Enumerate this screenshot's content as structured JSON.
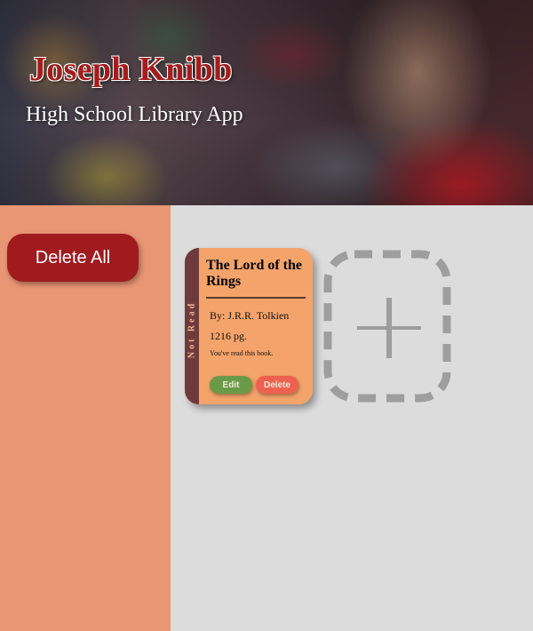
{
  "header": {
    "title": "Joseph Knibb",
    "subtitle": "High School Library App"
  },
  "sidebar": {
    "delete_all_label": "Delete All"
  },
  "books": [
    {
      "title": "The Lord of the Rings",
      "author": "By: J.R.R. Tolkien",
      "pages": "1216 pg.",
      "note": "You've read this book.",
      "status": "Not Read",
      "edit_label": "Edit",
      "delete_label": "Delete"
    }
  ],
  "colors": {
    "sidebar_bg": "#e99674",
    "main_bg": "#dcdcdc",
    "delete_all_button": "#a01a1e",
    "card_bg": "#f4a46a",
    "status_strip": "#6e3a3c",
    "edit_button": "#6a9a48",
    "delete_button": "#ee6050",
    "add_card_outline": "#9e9e9e"
  },
  "icons": {
    "add_book": "plus-icon"
  }
}
